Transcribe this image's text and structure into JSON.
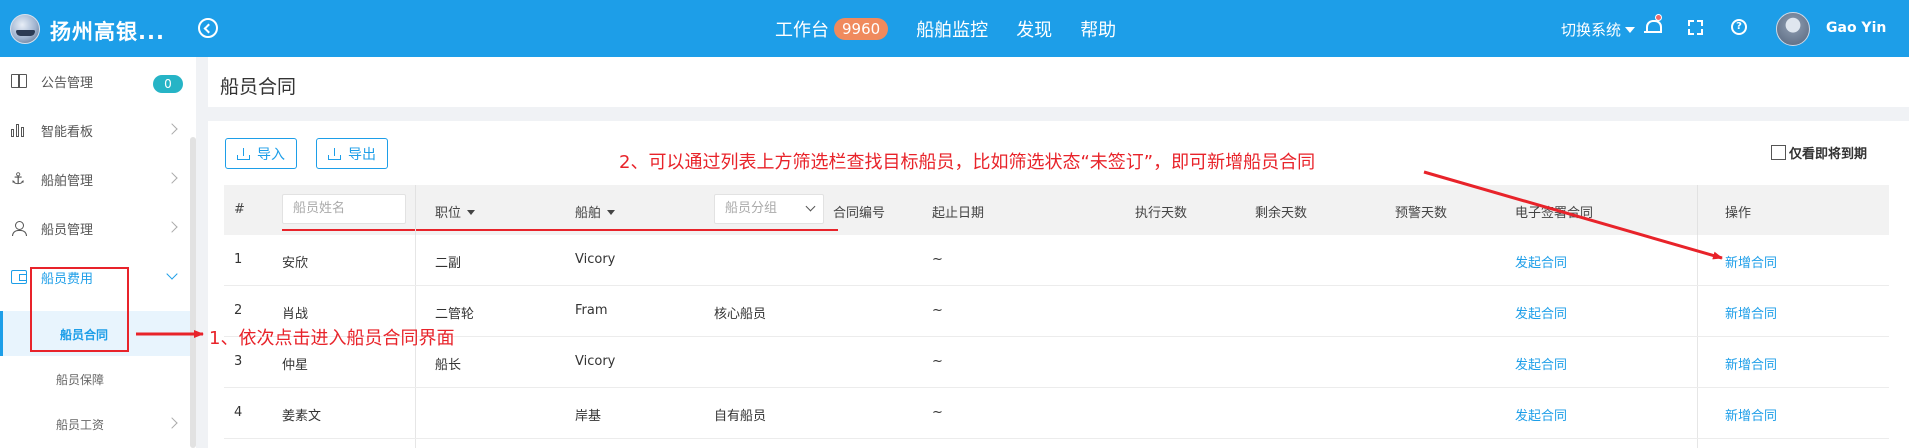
{
  "header": {
    "app_title": "扬州高银...",
    "nav": [
      {
        "label": "工作台",
        "badge": "9960"
      },
      {
        "label": "船舶监控"
      },
      {
        "label": "发现"
      },
      {
        "label": "帮助"
      }
    ],
    "switch_system": "切换系统",
    "user_name": "Gao Yin",
    "icons": [
      "collapse-icon",
      "bell-icon",
      "fullscreen-icon",
      "help-icon"
    ]
  },
  "sidebar": {
    "items": [
      {
        "label": "公告管理",
        "icon": "book-icon",
        "badge": "0"
      },
      {
        "label": "智能看板",
        "icon": "chart-icon"
      },
      {
        "label": "船舶管理",
        "icon": "anchor-icon"
      },
      {
        "label": "船员管理",
        "icon": "user-icon"
      },
      {
        "label": "船员费用",
        "icon": "wallet-icon",
        "expanded": true
      }
    ],
    "sub_items": [
      {
        "label": "船员合同",
        "selected": true
      },
      {
        "label": "船员保障"
      },
      {
        "label": "船员工资"
      }
    ]
  },
  "page": {
    "title": "船员合同",
    "import_label": "导入",
    "export_label": "导出",
    "expiring_only_label": "仅看即将到期"
  },
  "table": {
    "headers": {
      "index": "#",
      "name_placeholder": "船员姓名",
      "position": "职位",
      "ship": "船舶",
      "group_placeholder": "船员分组",
      "contract_no": "合同编号",
      "period": "起止日期",
      "exec_days": "执行天数",
      "remain_days": "剩余天数",
      "warn_days": "预警天数",
      "e_contract": "电子签署合同",
      "action": "操作"
    },
    "rows": [
      {
        "index": "1",
        "name": "安欣",
        "position": "二副",
        "ship": "Vicory",
        "group": "",
        "period": "~",
        "e_contract": "发起合同",
        "action": "新增合同"
      },
      {
        "index": "2",
        "name": "肖战",
        "position": "二管轮",
        "ship": "Fram",
        "group": "核心船员",
        "period": "~",
        "e_contract": "发起合同",
        "action": "新增合同"
      },
      {
        "index": "3",
        "name": "仲星",
        "position": "船长",
        "ship": "Vicory",
        "group": "",
        "period": "~",
        "e_contract": "发起合同",
        "action": "新增合同"
      },
      {
        "index": "4",
        "name": "姜素文",
        "position": "",
        "ship": "岸基",
        "group": "自有船员",
        "period": "~",
        "e_contract": "发起合同",
        "action": "新增合同"
      }
    ]
  },
  "annotations": {
    "step1": "1、依次点击进入船员合同界面",
    "step2": "2、可以通过列表上方筛选栏查找目标船员，比如筛选状态“未签订”，即可新增船员合同"
  },
  "colors": {
    "primary": "#1d9ee8",
    "annotation_red": "#e8232a",
    "badge_orange": "#f08a5d",
    "badge_teal": "#26b4c6"
  }
}
